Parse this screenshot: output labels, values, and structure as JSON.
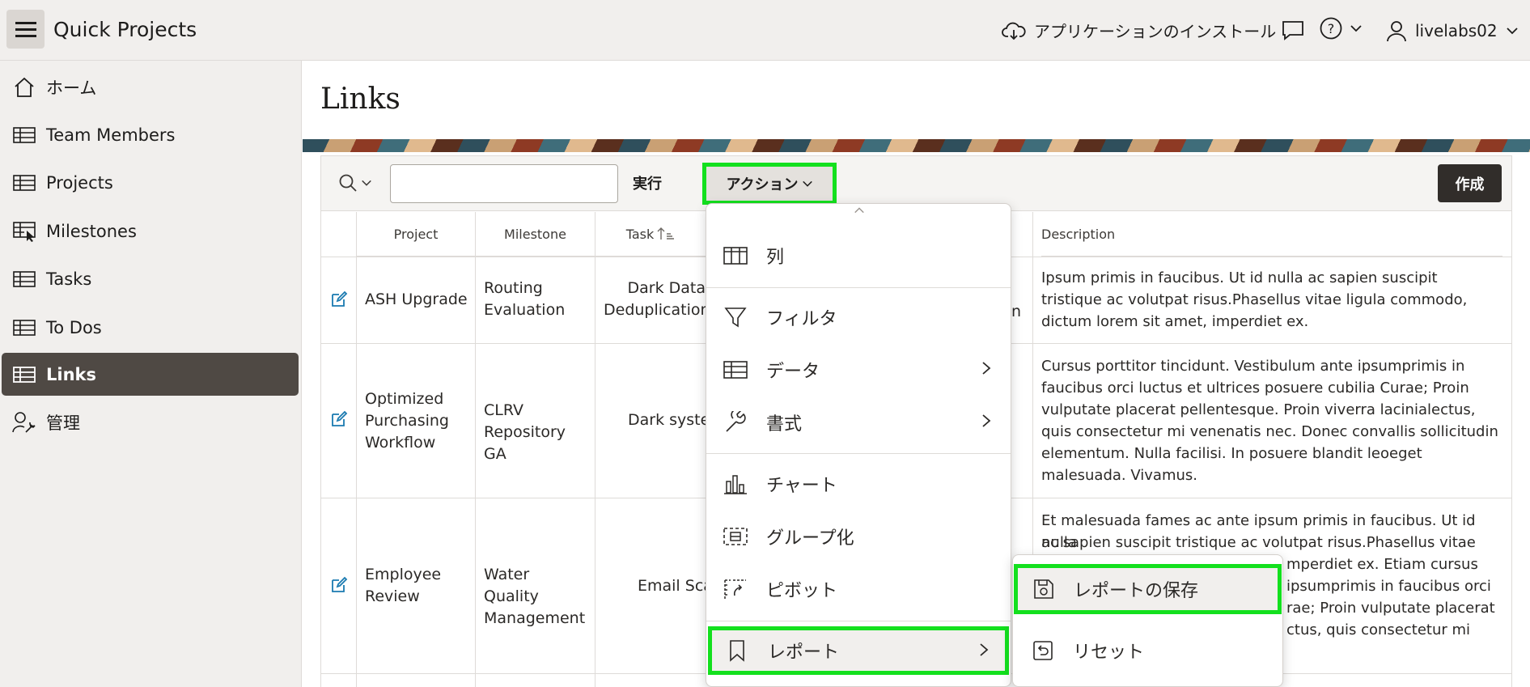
{
  "header": {
    "app_title": "Quick Projects",
    "install_label": "アプリケーションのインストール",
    "username": "livelabs02"
  },
  "sidebar": {
    "items": [
      {
        "label": "ホーム",
        "icon": "home-icon"
      },
      {
        "label": "Team Members",
        "icon": "table-icon"
      },
      {
        "label": "Projects",
        "icon": "table-icon"
      },
      {
        "label": "Milestones",
        "icon": "table-cursor-icon"
      },
      {
        "label": "Tasks",
        "icon": "table-icon"
      },
      {
        "label": "To Dos",
        "icon": "table-icon"
      },
      {
        "label": "Links",
        "icon": "table-icon",
        "active": true
      },
      {
        "label": "管理",
        "icon": "user-wrench-icon"
      }
    ]
  },
  "page": {
    "title": "Links"
  },
  "toolbar": {
    "search_value": "",
    "go_label": "実行",
    "actions_label": "アクション",
    "create_label": "作成"
  },
  "table": {
    "columns": [
      "Project",
      "Milestone",
      "Task",
      "Description"
    ],
    "rows": [
      {
        "project": "ASH Upgrade",
        "milestone": "Routing Evaluation",
        "task": "Dark Data Deduplication",
        "extra": "n",
        "description": "Ipsum primis in faucibus. Ut id nulla ac sapien suscipit tristique ac volutpat risus.Phasellus vitae ligula commodo, dictum lorem sit amet, imperdiet ex."
      },
      {
        "project": "Optimized Purchasing Workflow",
        "milestone": "CLRV Repository GA",
        "task": "Dark system",
        "extra": "",
        "description": "Cursus porttitor tincidunt. Vestibulum ante ipsumprimis in faucibus orci luctus et ultrices posuere cubilia Curae; Proin vulputate placerat pellentesque. Proin viverra lacinialectus, quis consectetur mi venenatis nec. Donec convallis sollicitudin elementum. Nulla facilisi. In posuere blandit leoeget malesuada. Vivamus."
      },
      {
        "project": "Employee Review",
        "milestone": "Water Quality Management",
        "task": "Email Scan",
        "extra": "",
        "description_lines": [
          "Et malesuada fames ac ante ipsum primis in faucibus. Ut id nulla",
          "ac sapien suscipit tristique ac volutpat risus.Phasellus vitae ligula",
          "mperdiet ex. Etiam cursus",
          "ipsumprimis in faucibus orci",
          "rae; Proin vulputate placerat",
          "ctus, quis consectetur mi"
        ]
      }
    ]
  },
  "actions_menu": {
    "items": [
      {
        "label": "列",
        "icon": "columns-icon"
      },
      {
        "label": "フィルタ",
        "icon": "filter-icon"
      },
      {
        "label": "データ",
        "icon": "table-icon",
        "submenu": true
      },
      {
        "label": "書式",
        "icon": "wrench-icon",
        "submenu": true
      },
      {
        "label": "チャート",
        "icon": "bar-chart-icon"
      },
      {
        "label": "グループ化",
        "icon": "group-icon"
      },
      {
        "label": "ピボット",
        "icon": "pivot-icon"
      },
      {
        "label": "レポート",
        "icon": "bookmark-icon",
        "submenu": true,
        "highlighted": true
      }
    ]
  },
  "report_submenu": {
    "items": [
      {
        "label": "レポートの保存",
        "icon": "save-icon",
        "highlighted": true
      },
      {
        "label": "リセット",
        "icon": "reset-icon"
      }
    ]
  },
  "colors": {
    "highlight": "#13e01e",
    "active_nav": "#4f4944",
    "create_button": "#312d2a",
    "edit_icon": "#1a7ab0"
  }
}
